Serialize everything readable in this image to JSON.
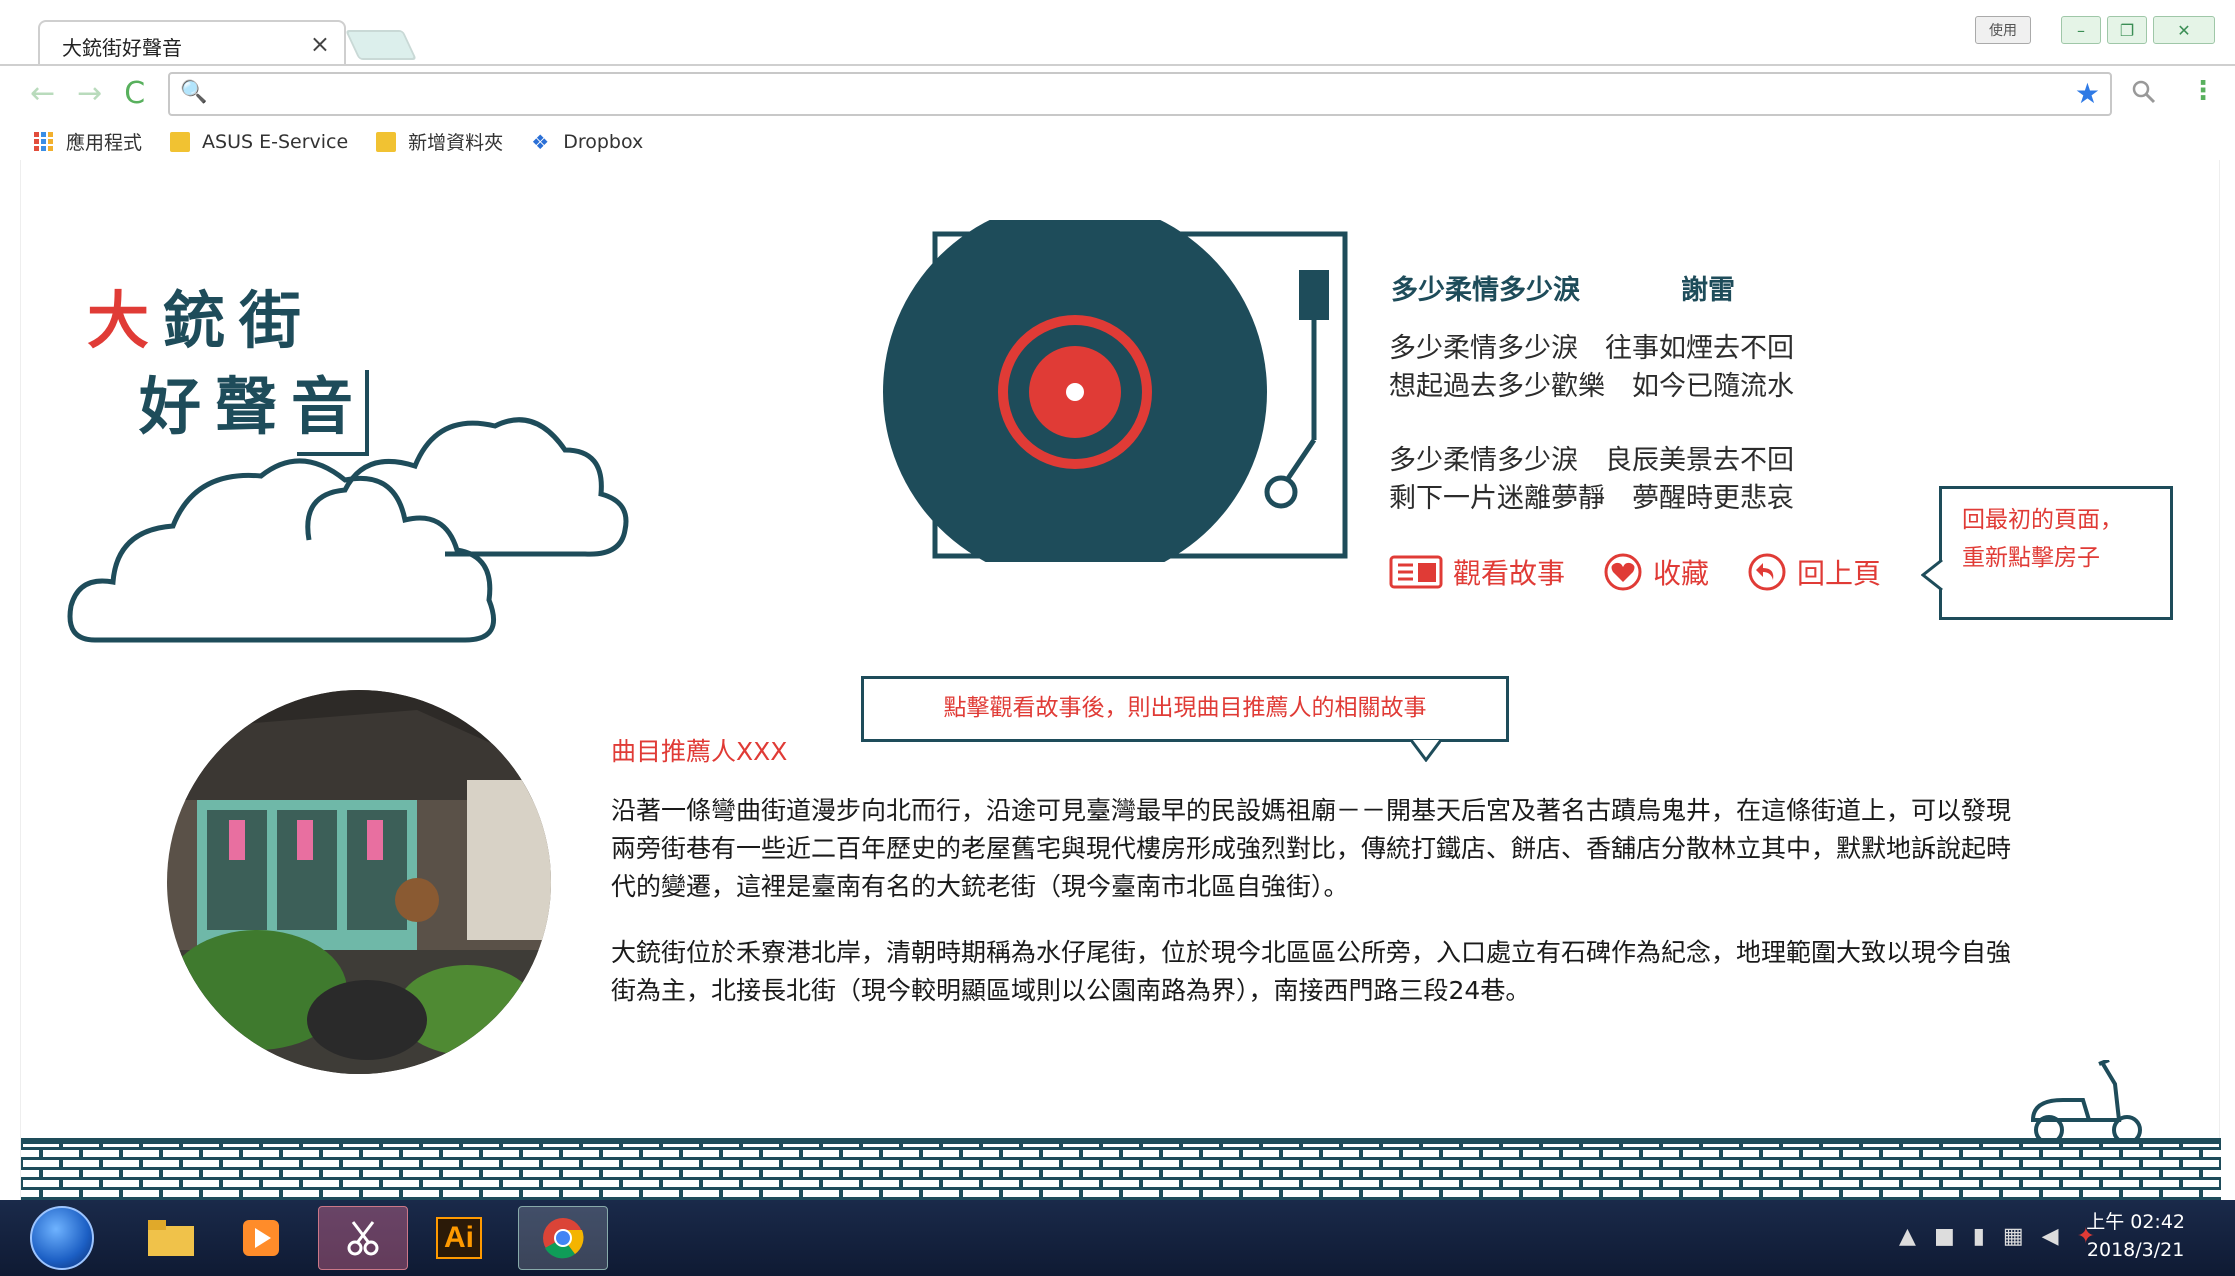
{
  "browser": {
    "tab_title": "大銃街好聲音",
    "tab_close": "×",
    "user_button": "使用",
    "window_controls": [
      "–",
      "❐",
      "✕"
    ],
    "nav": {
      "back": "←",
      "forward": "→",
      "reload": "C"
    },
    "omnibox": {
      "value": "",
      "search_icon": "🔍",
      "star_icon": "★"
    },
    "menu": "⋮",
    "bookmarks": [
      {
        "label": "應用程式",
        "icon": "apps-icon"
      },
      {
        "label": "ASUS E-Service",
        "icon": "folder-icon"
      },
      {
        "label": "新增資料夾",
        "icon": "folder-icon"
      },
      {
        "label": "Dropbox",
        "icon": "dropbox-icon"
      }
    ]
  },
  "logo": {
    "line1": [
      "大",
      "銃",
      "街"
    ],
    "line2": [
      "好",
      "聲",
      "音"
    ]
  },
  "song": {
    "title": "多少柔情多少淚",
    "artist": "謝雷",
    "lyrics": [
      "多少柔情多少淚　往事如煙去不回",
      "想起過去多少歡樂　如今已隨流水",
      "多少柔情多少淚　良辰美景去不回",
      "剩下一片迷離夢靜　夢醒時更悲哀"
    ]
  },
  "actions": {
    "story": "觀看故事",
    "favorite": "收藏",
    "back": "回上頁"
  },
  "callouts": {
    "right_line1": "回最初的頁面，",
    "right_line2": "重新點擊房子",
    "center": "點擊觀看故事後，則出現曲目推薦人的相關故事"
  },
  "recommender": "曲目推薦人XXX",
  "story": {
    "paragraph1": "沿著一條彎曲街道漫步向北而行，沿途可見臺灣最早的民設媽祖廟－－開基天后宮及著名古蹟烏鬼井，在這條街道上，可以發現兩旁街巷有一些近二百年歷史的老屋舊宅與現代樓房形成強烈對比，傳統打鐵店、餅店、香舖店分散林立其中，默默地訴說起時代的變遷，這裡是臺南有名的大銃老街（現今臺南市北區自強街）。",
    "paragraph2": "大銃街位於禾寮港北岸，清朝時期稱為水仔尾街，位於現今北區區公所旁，入口處立有石碑作為紀念，地理範圍大致以現今自強街為主，北接長北街（現今較明顯區域則以公園南路為界），南接西門路三段24巷。"
  },
  "taskbar": {
    "ai_label": "Ai",
    "clock_time": "上午 02:42",
    "clock_date": "2018/3/21"
  },
  "colors": {
    "teal": "#1e4c5a",
    "red": "#e03b36"
  }
}
